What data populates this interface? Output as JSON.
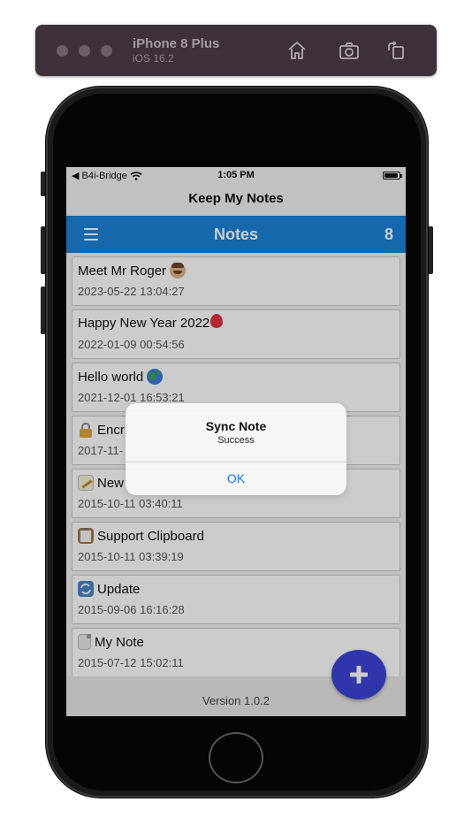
{
  "simulator": {
    "device": "iPhone 8 Plus",
    "os": "iOS 16.2",
    "traffic_color": "#6a5d66"
  },
  "status_bar": {
    "carrier": "◀ B4i-Bridge",
    "time": "1:05 PM"
  },
  "nav": {
    "title": "Keep My Notes"
  },
  "app_bar": {
    "title": "Notes",
    "count": "8",
    "color": "#1a83d6"
  },
  "notes": [
    {
      "title": "Meet Mr Roger",
      "date": "2023-05-22 13:04:27",
      "icon": "man-face-icon"
    },
    {
      "title": "Happy New Year 2022",
      "date": "2022-01-09 00:54:56",
      "icon": "balloon-icon"
    },
    {
      "title": "Hello world",
      "date": "2021-12-01 16:53:21",
      "icon": "globe-icon"
    },
    {
      "title": "Encr",
      "date": "2017-11-",
      "icon": "lock-icon"
    },
    {
      "title": "New",
      "date": "2015-10-11 03:40:11",
      "icon": "memo-icon"
    },
    {
      "title": "Support Clipboard",
      "date": "2015-10-11 03:39:19",
      "icon": "clipboard-icon"
    },
    {
      "title": "Update",
      "date": "2015-09-06 16:16:28",
      "icon": "sync-icon"
    },
    {
      "title": "My Note",
      "date": "2015-07-12 15:02:11",
      "icon": "document-icon"
    }
  ],
  "footer": {
    "version": "Version 1.0.2"
  },
  "fab": {
    "color": "#3b44d6",
    "icon": "plus-icon"
  },
  "alert": {
    "title": "Sync Note",
    "message": "Success",
    "button": "OK"
  }
}
